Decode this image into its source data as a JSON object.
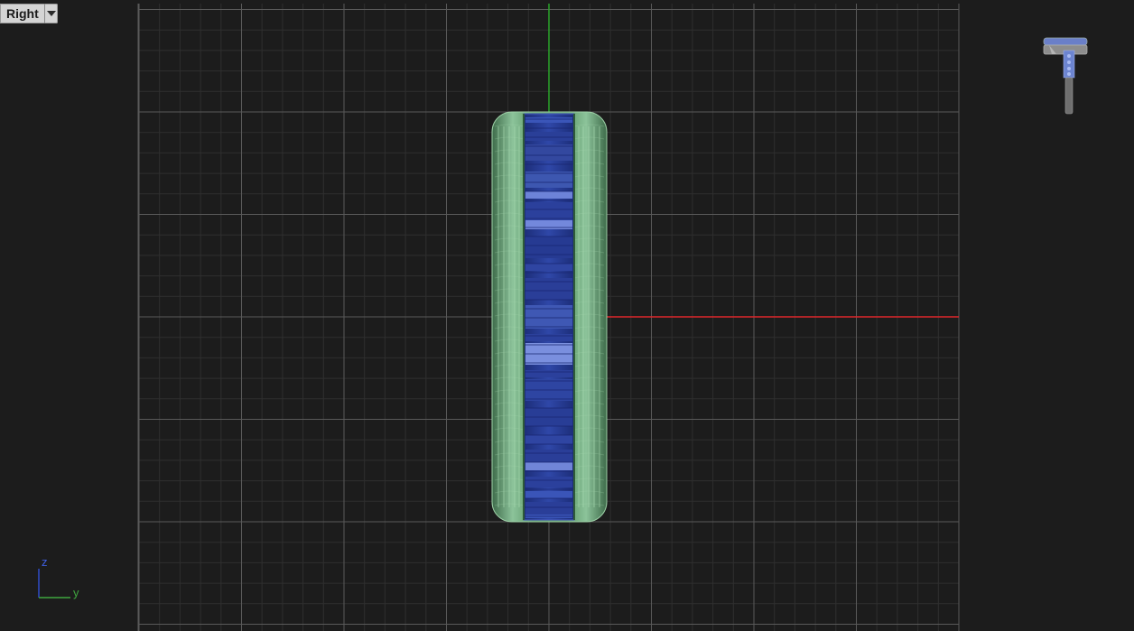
{
  "viewport": {
    "view_name": "Right",
    "menu_icon": "chevron-down-icon",
    "background_color": "#1c1c1c",
    "grid_minor_color": "#2c2c2c",
    "grid_major_color": "#5a5a5a",
    "axis_x_color": "#e0262b",
    "axis_y_color": "#2aa52a",
    "object_outer_color": "#5e9a6a",
    "object_core_color": "#2f47a8"
  },
  "axis_widget": {
    "z_label": "z",
    "y_label": "y",
    "z_color": "#2f4cc8",
    "y_color": "#3fa63f"
  },
  "nav_preview": {
    "icon": "model-preview-icon"
  }
}
